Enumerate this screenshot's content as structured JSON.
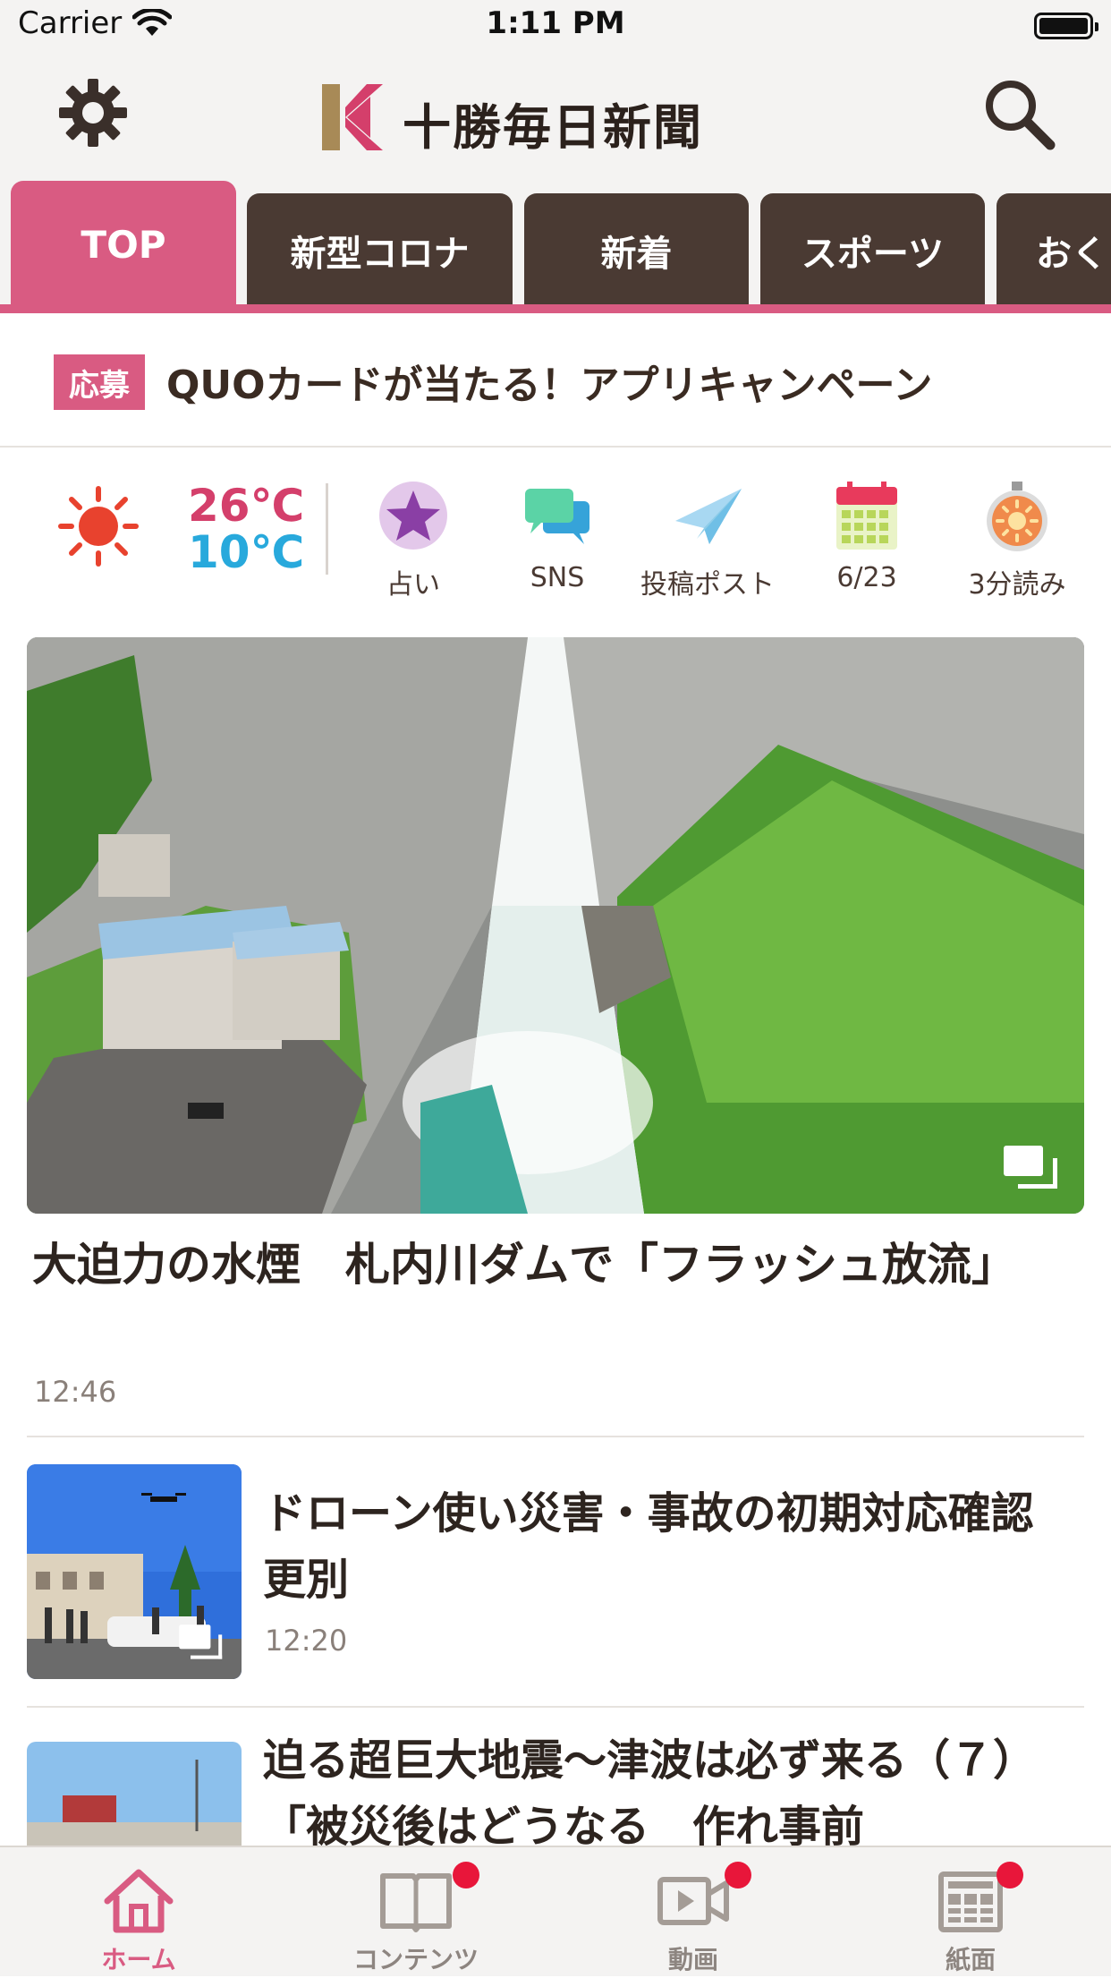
{
  "status_bar": {
    "carrier": "Carrier",
    "time": "1:11 PM"
  },
  "header": {
    "logo_text": "十勝毎日新聞"
  },
  "tabs": [
    {
      "label": "TOP",
      "active": true
    },
    {
      "label": "新型コロナ",
      "active": false
    },
    {
      "label": "新着",
      "active": false
    },
    {
      "label": "スポーツ",
      "active": false
    },
    {
      "label": "おく",
      "active": false
    }
  ],
  "banner": {
    "badge": "応募",
    "text": "QUOカードが当たる！アプリキャンペーン"
  },
  "weather": {
    "high": "26℃",
    "low": "10℃",
    "icon": "sun-icon"
  },
  "quick_links": [
    {
      "label": "占い",
      "icon": "fortune-star-icon"
    },
    {
      "label": "SNS",
      "icon": "chat-bubbles-icon"
    },
    {
      "label": "投稿ポスト",
      "icon": "paper-plane-icon"
    },
    {
      "label": "6/23",
      "icon": "calendar-icon"
    },
    {
      "label": "3分読み",
      "icon": "stopwatch-icon"
    }
  ],
  "hero": {
    "title": "大迫力の水煙　札内川ダムで「フラッシュ放流」",
    "time": "12:46",
    "image": "dam-flash-discharge-photo"
  },
  "articles": [
    {
      "title": "ドローン使い災害・事故の初期対応確認　更別",
      "time": "12:20",
      "image": "drone-training-photo"
    },
    {
      "title": "迫る超巨大地震～津波は必ず来る（７）「被災後はどうなる　作れ事前",
      "time": "",
      "image": "harbor-photo"
    }
  ],
  "bottom_nav": [
    {
      "label": "ホーム",
      "icon": "home-icon",
      "active": true,
      "badge": false
    },
    {
      "label": "コンテンツ",
      "icon": "book-icon",
      "active": false,
      "badge": true
    },
    {
      "label": "動画",
      "icon": "video-icon",
      "active": false,
      "badge": true
    },
    {
      "label": "紙面",
      "icon": "newspaper-icon",
      "active": false,
      "badge": true
    }
  ],
  "colors": {
    "accent": "#d95b82",
    "tab_dark": "#4a3a33",
    "badge_red": "#e8163a",
    "temp_high": "#d43f6b",
    "temp_low": "#28a9dc"
  }
}
